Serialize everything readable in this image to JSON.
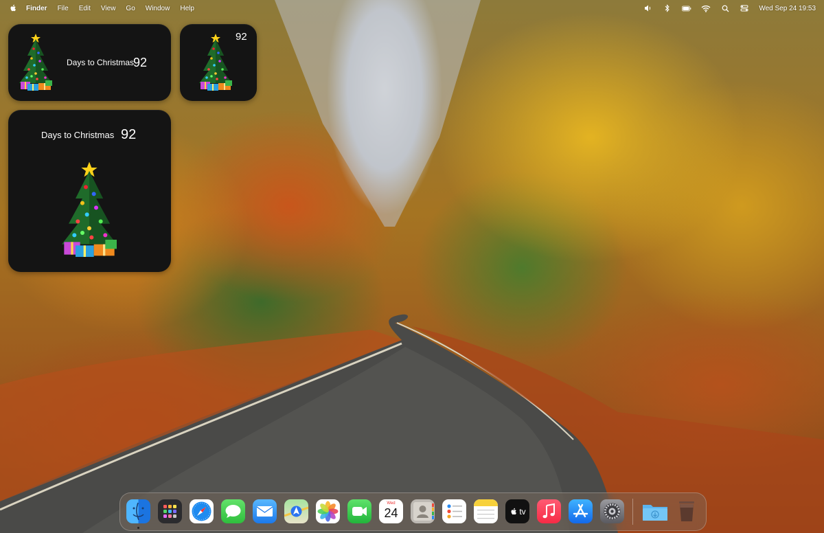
{
  "menubar": {
    "app_name": "Finder",
    "menus": [
      "File",
      "Edit",
      "View",
      "Go",
      "Window",
      "Help"
    ],
    "clock": "Wed Sep 24  19:53"
  },
  "widgets": {
    "medium": {
      "label": "Days to Christmas",
      "count": "92"
    },
    "small": {
      "count": "92"
    },
    "large": {
      "label": "Days to Christmas",
      "count": "92"
    }
  },
  "dock": {
    "calendar": {
      "month": "Wed",
      "day": "24"
    },
    "apps": [
      "finder-icon",
      "launchpad-icon",
      "safari-icon",
      "messages-icon",
      "mail-icon",
      "maps-icon",
      "photos-icon",
      "facetime-icon",
      "calendar-icon",
      "contacts-icon",
      "reminders-icon",
      "notes-icon",
      "tv-icon",
      "music-icon",
      "app-store-icon",
      "system-settings-icon",
      "downloads-folder-icon",
      "trash-icon"
    ],
    "tv_label": "tv"
  },
  "colors": {
    "widget_bg": "#141414",
    "accent_blue": "#2f8cf5"
  }
}
